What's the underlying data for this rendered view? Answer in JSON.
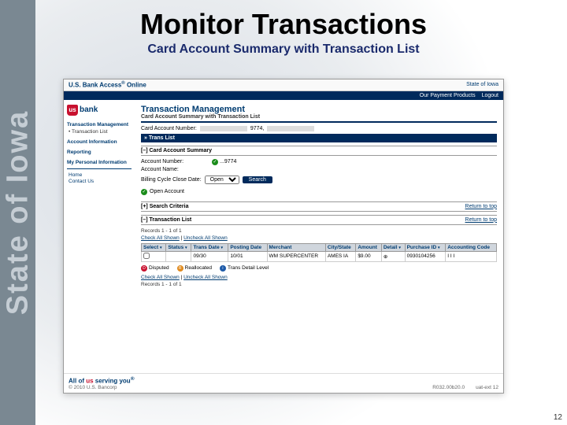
{
  "slide": {
    "title": "Monitor Transactions",
    "subtitle": "Card Account Summary with Transaction List",
    "page_number": "12",
    "sidebar_text": "State of Iowa"
  },
  "header": {
    "product": "U.S. Bank Access",
    "product_suffix": "Online",
    "reg": "®",
    "tenant": "State of Iowa"
  },
  "navbar": {
    "link_products": "Our Payment Products",
    "link_logout": "Logout"
  },
  "logo": {
    "us": "us",
    "bank": "bank"
  },
  "leftnav": {
    "sec_tm": "Transaction Management",
    "item_tl": "• Transaction List",
    "sec_ai": "Account Information",
    "sec_rep": "Reporting",
    "sec_mpi": "My Personal Information",
    "home": "Home",
    "contact": "Contact Us"
  },
  "main": {
    "h3": "Transaction Management",
    "sub": "Card Account Summary with Transaction List",
    "card_label": "Card Account Number:",
    "card_masked_suffix": "9774,",
    "tl_bar": "» Trans List",
    "cas_hdr": "[–] Card Account Summary",
    "acct_num_label": "Account Number:",
    "acct_num_value": "...9774",
    "acct_name_label": "Account Name:",
    "cycle_label": "Billing Cycle Close Date:",
    "cycle_value": "Open",
    "search_btn": "Search",
    "open_account": "Open Account",
    "sc_hdr": "[+] Search Criteria",
    "return_top": "Return to top",
    "tl_hdr": "[–] Transaction List",
    "records": "Records 1 - 1 of 1",
    "check_all": "Check All Shown",
    "uncheck_all": "Uncheck All Shown",
    "legend_disputed": "Disputed",
    "legend_realloc": "Reallocated",
    "legend_detail": "Trans Detail Level"
  },
  "table": {
    "cols": {
      "select": "Select",
      "status": "Status",
      "trans_date": "Trans Date",
      "posting_date": "Posting Date",
      "merchant": "Merchant",
      "city_state": "City/State",
      "amount": "Amount",
      "detail": "Detail",
      "purchase_id": "Purchase ID",
      "accounting_code": "Accounting Code"
    },
    "row": {
      "trans_date": "09/30",
      "posting_date": "10/01",
      "merchant": "WM SUPERCENTER",
      "city_state": "AMES IA",
      "amount": "$9.00",
      "detail": "⊕",
      "purchase_id": "0930104256",
      "accounting_code": "I I I"
    }
  },
  "footer": {
    "tagline_pre": "All of ",
    "tagline_us": "us",
    "tagline_post": " serving you",
    "copyright": "© 2010 U.S. Bancorp",
    "code": "R032.00b20.0",
    "col": "uat-ext 12"
  }
}
